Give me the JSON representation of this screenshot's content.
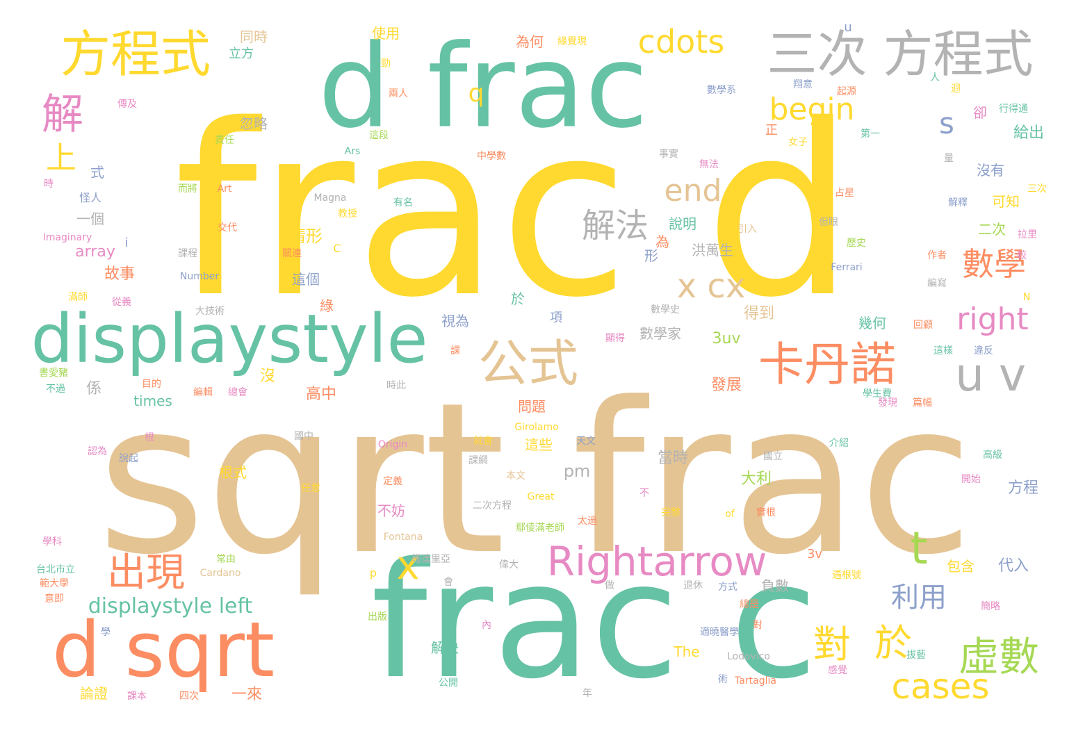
{
  "palette": {
    "green": "#66C2A5",
    "yellow": "#FFD92F",
    "tan": "#E5C494",
    "orange": "#FC8D62",
    "gray": "#B3B3B3",
    "pink": "#E78AC3",
    "lime": "#A6D854",
    "blue": "#8DA0CB"
  },
  "words": [
    {
      "text": "frac d",
      "color": "yellow",
      "weight": 1.0
    },
    {
      "text": "sqrt frac",
      "color": "tan",
      "weight": 0.95
    },
    {
      "text": "frac c",
      "color": "green",
      "weight": 0.9
    },
    {
      "text": "d frac",
      "color": "green",
      "weight": 0.65
    },
    {
      "text": "displaystyle",
      "color": "green",
      "weight": 0.4
    },
    {
      "text": "方程式",
      "color": "yellow",
      "weight": 0.3
    },
    {
      "text": "三次 方程式",
      "color": "gray",
      "weight": 0.3
    },
    {
      "text": "d sqrt",
      "color": "orange",
      "weight": 0.45
    },
    {
      "text": "cdots",
      "color": "yellow",
      "weight": 0.2
    },
    {
      "text": "卡丹諾",
      "color": "orange",
      "weight": 0.3
    },
    {
      "text": "公式",
      "color": "tan",
      "weight": 0.3
    },
    {
      "text": "Rightarrow",
      "color": "pink",
      "weight": 0.25
    },
    {
      "text": "u v",
      "color": "gray",
      "weight": 0.3
    },
    {
      "text": "解法",
      "color": "gray",
      "weight": 0.2
    },
    {
      "text": "x cx",
      "color": "tan",
      "weight": 0.2
    },
    {
      "text": "end",
      "color": "tan",
      "weight": 0.2
    },
    {
      "text": "begin",
      "color": "yellow",
      "weight": 0.18
    },
    {
      "text": "right",
      "color": "pink",
      "weight": 0.18
    },
    {
      "text": "數學",
      "color": "orange",
      "weight": 0.2
    },
    {
      "text": "虛數",
      "color": "lime",
      "weight": 0.25
    },
    {
      "text": "cases",
      "color": "yellow",
      "weight": 0.22
    },
    {
      "text": "出現",
      "color": "orange",
      "weight": 0.2
    },
    {
      "text": "解",
      "color": "pink",
      "weight": 0.2
    },
    {
      "text": "上",
      "color": "yellow",
      "weight": 0.15
    },
    {
      "text": "t",
      "color": "lime",
      "weight": 0.25
    },
    {
      "text": "x",
      "color": "yellow",
      "weight": 0.2
    },
    {
      "text": "q",
      "color": "yellow",
      "weight": 0.15
    },
    {
      "text": "s",
      "color": "blue",
      "weight": 0.15
    },
    {
      "text": "對",
      "color": "yellow",
      "weight": 0.2
    },
    {
      "text": "於",
      "color": "yellow",
      "weight": 0.2
    },
    {
      "text": "利用",
      "color": "blue",
      "weight": 0.15
    },
    {
      "text": "displaystyle left",
      "color": "green",
      "weight": 0.1
    },
    {
      "text": "u",
      "color": "blue",
      "weight": 0.05
    },
    {
      "text": "同時",
      "color": "tan",
      "weight": 0.05
    },
    {
      "text": "使用",
      "color": "yellow",
      "weight": 0.05
    },
    {
      "text": "為何",
      "color": "orange",
      "weight": 0.05
    },
    {
      "text": "緣覺現",
      "color": "yellow",
      "weight": 0.03
    },
    {
      "text": "立方",
      "color": "green",
      "weight": 0.05
    },
    {
      "text": "忽略",
      "color": "gray",
      "weight": 0.05
    },
    {
      "text": "傳及",
      "color": "pink",
      "weight": 0.03
    },
    {
      "text": "勁",
      "color": "yellow",
      "weight": 0.03
    },
    {
      "text": "兩人",
      "color": "orange",
      "weight": 0.03
    },
    {
      "text": "這段",
      "color": "lime",
      "weight": 0.03
    },
    {
      "text": "責任",
      "color": "lime",
      "weight": 0.03
    },
    {
      "text": "Ars",
      "color": "green",
      "weight": 0.03
    },
    {
      "text": "中學數",
      "color": "orange",
      "weight": 0.03
    },
    {
      "text": "式",
      "color": "blue",
      "weight": 0.05
    },
    {
      "text": "時",
      "color": "pink",
      "weight": 0.03
    },
    {
      "text": "怪人",
      "color": "blue",
      "weight": 0.03
    },
    {
      "text": "而將",
      "color": "lime",
      "weight": 0.03
    },
    {
      "text": "Art",
      "color": "orange",
      "weight": 0.03
    },
    {
      "text": "Magna",
      "color": "gray",
      "weight": 0.03
    },
    {
      "text": "有名",
      "color": "green",
      "weight": 0.03
    },
    {
      "text": "教授",
      "color": "yellow",
      "weight": 0.03
    },
    {
      "text": "一個",
      "color": "gray",
      "weight": 0.05
    },
    {
      "text": "交代",
      "color": "orange",
      "weight": 0.03
    },
    {
      "text": "Imaginary",
      "color": "pink",
      "weight": 0.03
    },
    {
      "text": "i",
      "color": "blue",
      "weight": 0.03
    },
    {
      "text": "課程",
      "color": "gray",
      "weight": 0.03
    },
    {
      "text": "關連",
      "color": "orange",
      "weight": 0.03
    },
    {
      "text": "array",
      "color": "pink",
      "weight": 0.06
    },
    {
      "text": "情形",
      "color": "yellow",
      "weight": 0.06
    },
    {
      "text": "C",
      "color": "yellow",
      "weight": 0.03
    },
    {
      "text": "故事",
      "color": "orange",
      "weight": 0.06
    },
    {
      "text": "Number",
      "color": "blue",
      "weight": 0.03
    },
    {
      "text": "這個",
      "color": "blue",
      "weight": 0.05
    },
    {
      "text": "為",
      "color": "orange",
      "weight": 0.05
    },
    {
      "text": "形",
      "color": "blue",
      "weight": 0.05
    },
    {
      "text": "洪萬生",
      "color": "gray",
      "weight": 0.05
    },
    {
      "text": "說明",
      "color": "green",
      "weight": 0.05
    },
    {
      "text": "滿師",
      "color": "yellow",
      "weight": 0.03
    },
    {
      "text": "從義",
      "color": "pink",
      "weight": 0.03
    },
    {
      "text": "大技術",
      "color": "gray",
      "weight": 0.03
    },
    {
      "text": "綠",
      "color": "orange",
      "weight": 0.05
    },
    {
      "text": "於",
      "color": "green",
      "weight": 0.05
    },
    {
      "text": "得到",
      "color": "tan",
      "weight": 0.06
    },
    {
      "text": "視為",
      "color": "blue",
      "weight": 0.05
    },
    {
      "text": "項",
      "color": "blue",
      "weight": 0.04
    },
    {
      "text": "數學家",
      "color": "gray",
      "weight": 0.05
    },
    {
      "text": "幾何",
      "color": "green",
      "weight": 0.05
    },
    {
      "text": "3uv",
      "color": "lime",
      "weight": 0.06
    },
    {
      "text": "數學史",
      "color": "gray",
      "weight": 0.03
    },
    {
      "text": "顯得",
      "color": "pink",
      "weight": 0.03
    },
    {
      "text": "書愛豬",
      "color": "lime",
      "weight": 0.03
    },
    {
      "text": "不過",
      "color": "green",
      "weight": 0.03
    },
    {
      "text": "目的",
      "color": "orange",
      "weight": 0.03
    },
    {
      "text": "係",
      "color": "gray",
      "weight": 0.05
    },
    {
      "text": "沒",
      "color": "yellow",
      "weight": 0.05
    },
    {
      "text": "編輯",
      "color": "orange",
      "weight": 0.03
    },
    {
      "text": "總會",
      "color": "pink",
      "weight": 0.03
    },
    {
      "text": "times",
      "color": "green",
      "weight": 0.06
    },
    {
      "text": "高中",
      "color": "orange",
      "weight": 0.05
    },
    {
      "text": "時此",
      "color": "gray",
      "weight": 0.03
    },
    {
      "text": "問題",
      "color": "orange",
      "weight": 0.05
    },
    {
      "text": "發展",
      "color": "orange",
      "weight": 0.05
    },
    {
      "text": "課",
      "color": "orange",
      "weight": 0.03
    },
    {
      "text": "根",
      "color": "pink",
      "weight": 0.03
    },
    {
      "text": "認為",
      "color": "pink",
      "weight": 0.03
    },
    {
      "text": "說起",
      "color": "blue",
      "weight": 0.03
    },
    {
      "text": "國中",
      "color": "gray",
      "weight": 0.03
    },
    {
      "text": "根式",
      "color": "yellow",
      "weight": 0.05
    },
    {
      "text": "Origin",
      "color": "pink",
      "weight": 0.03
    },
    {
      "text": "這些",
      "color": "yellow",
      "weight": 0.05
    },
    {
      "text": "pm",
      "color": "gray",
      "weight": 0.06
    },
    {
      "text": "天文",
      "color": "blue",
      "weight": 0.03
    },
    {
      "text": "Girolamo",
      "color": "yellow",
      "weight": 0.03
    },
    {
      "text": "就會",
      "color": "yellow",
      "weight": 0.03
    },
    {
      "text": "課綱",
      "color": "gray",
      "weight": 0.03
    },
    {
      "text": "當時",
      "color": "gray",
      "weight": 0.05
    },
    {
      "text": "大利",
      "color": "lime",
      "weight": 0.05
    },
    {
      "text": "任意",
      "color": "yellow",
      "weight": 0.03
    },
    {
      "text": "定義",
      "color": "orange",
      "weight": 0.03
    },
    {
      "text": "本文",
      "color": "tan",
      "weight": 0.03
    },
    {
      "text": "不妨",
      "color": "pink",
      "weight": 0.05
    },
    {
      "text": "二次方程",
      "color": "gray",
      "weight": 0.03
    },
    {
      "text": "Great",
      "color": "yellow",
      "weight": 0.03
    },
    {
      "text": "不",
      "color": "pink",
      "weight": 0.03
    },
    {
      "text": "太過",
      "color": "orange",
      "weight": 0.03
    },
    {
      "text": "完整",
      "color": "yellow",
      "weight": 0.03
    },
    {
      "text": "of",
      "color": "yellow",
      "weight": 0.03
    },
    {
      "text": "實根",
      "color": "orange",
      "weight": 0.03
    },
    {
      "text": "方程",
      "color": "blue",
      "weight": 0.06
    },
    {
      "text": "學科",
      "color": "pink",
      "weight": 0.03
    },
    {
      "text": "Fontana",
      "color": "tan",
      "weight": 0.03
    },
    {
      "text": "鄢倰滿老師",
      "color": "lime",
      "weight": 0.03
    },
    {
      "text": "台北市立",
      "color": "green",
      "weight": 0.03
    },
    {
      "text": "範大學",
      "color": "orange",
      "weight": 0.03
    },
    {
      "text": "常由",
      "color": "lime",
      "weight": 0.03
    },
    {
      "text": "Cardano",
      "color": "tan",
      "weight": 0.03
    },
    {
      "text": "p",
      "color": "yellow",
      "weight": 0.04
    },
    {
      "text": "塔達里亞",
      "color": "gray",
      "weight": 0.03
    },
    {
      "text": "偉大",
      "color": "gray",
      "weight": 0.03
    },
    {
      "text": "會",
      "color": "gray",
      "weight": 0.03
    },
    {
      "text": "3v",
      "color": "orange",
      "weight": 0.05
    },
    {
      "text": "負數",
      "color": "gray",
      "weight": 0.05
    },
    {
      "text": "包含",
      "color": "yellow",
      "weight": 0.05
    },
    {
      "text": "代入",
      "color": "blue",
      "weight": 0.06
    },
    {
      "text": "意即",
      "color": "orange",
      "weight": 0.03
    },
    {
      "text": "學",
      "color": "blue",
      "weight": 0.03
    },
    {
      "text": "出版",
      "color": "lime",
      "weight": 0.03
    },
    {
      "text": "內",
      "color": "pink",
      "weight": 0.03
    },
    {
      "text": "解決",
      "color": "green",
      "weight": 0.05
    },
    {
      "text": "The",
      "color": "yellow",
      "weight": 0.05
    },
    {
      "text": "退休",
      "color": "gray",
      "weight": 0.03
    },
    {
      "text": "方式",
      "color": "blue",
      "weight": 0.03
    },
    {
      "text": "做",
      "color": "gray",
      "weight": 0.03
    },
    {
      "text": "總是",
      "color": "orange",
      "weight": 0.03
    },
    {
      "text": "遇根號",
      "color": "yellow",
      "weight": 0.03
    },
    {
      "text": "簡略",
      "color": "pink",
      "weight": 0.03
    },
    {
      "text": "適曉醫學",
      "color": "blue",
      "weight": 0.03
    },
    {
      "text": "對",
      "color": "orange",
      "weight": 0.03
    },
    {
      "text": "Lodovico",
      "color": "gray",
      "weight": 0.03
    },
    {
      "text": "論證",
      "color": "yellow",
      "weight": 0.05
    },
    {
      "text": "課本",
      "color": "pink",
      "weight": 0.03
    },
    {
      "text": "四次",
      "color": "orange",
      "weight": 0.03
    },
    {
      "text": "一來",
      "color": "orange",
      "weight": 0.05
    },
    {
      "text": "公開",
      "color": "green",
      "weight": 0.03
    },
    {
      "text": "年",
      "color": "gray",
      "weight": 0.03
    },
    {
      "text": "術",
      "color": "blue",
      "weight": 0.03
    },
    {
      "text": "Tartaglia",
      "color": "orange",
      "weight": 0.03
    },
    {
      "text": "拔藝",
      "color": "green",
      "weight": 0.03
    },
    {
      "text": "感覺",
      "color": "pink",
      "weight": 0.03
    },
    {
      "text": "翔意",
      "color": "blue",
      "weight": 0.03
    },
    {
      "text": "起源",
      "color": "orange",
      "weight": 0.03
    },
    {
      "text": "數學系",
      "color": "blue",
      "weight": 0.03
    },
    {
      "text": "人",
      "color": "green",
      "weight": 0.03
    },
    {
      "text": "迴",
      "color": "yellow",
      "weight": 0.03
    },
    {
      "text": "卻",
      "color": "pink",
      "weight": 0.04
    },
    {
      "text": "行得通",
      "color": "green",
      "weight": 0.03
    },
    {
      "text": "給出",
      "color": "green",
      "weight": 0.05
    },
    {
      "text": "第一",
      "color": "green",
      "weight": 0.03
    },
    {
      "text": "正",
      "color": "orange",
      "weight": 0.04
    },
    {
      "text": "女子",
      "color": "yellow",
      "weight": 0.03
    },
    {
      "text": "事實",
      "color": "gray",
      "weight": 0.03
    },
    {
      "text": "量",
      "color": "gray",
      "weight": 0.03
    },
    {
      "text": "無法",
      "color": "pink",
      "weight": 0.03
    },
    {
      "text": "沒有",
      "color": "blue",
      "weight": 0.05
    },
    {
      "text": "占星",
      "color": "orange",
      "weight": 0.03
    },
    {
      "text": "解釋",
      "color": "blue",
      "weight": 0.03
    },
    {
      "text": "三次",
      "color": "yellow",
      "weight": 0.03
    },
    {
      "text": "可知",
      "color": "yellow",
      "weight": 0.05
    },
    {
      "text": "但眼",
      "color": "gray",
      "weight": 0.03
    },
    {
      "text": "引入",
      "color": "tan",
      "weight": 0.03
    },
    {
      "text": "二次",
      "color": "lime",
      "weight": 0.05
    },
    {
      "text": "拉里",
      "color": "pink",
      "weight": 0.03
    },
    {
      "text": "歷史",
      "color": "lime",
      "weight": 0.03
    },
    {
      "text": "Ferrari",
      "color": "blue",
      "weight": 0.03
    },
    {
      "text": "作者",
      "color": "orange",
      "weight": 0.03
    },
    {
      "text": "較",
      "color": "pink",
      "weight": 0.03
    },
    {
      "text": "編寫",
      "color": "gray",
      "weight": 0.03
    },
    {
      "text": "N",
      "color": "yellow",
      "weight": 0.03
    },
    {
      "text": "回顧",
      "color": "orange",
      "weight": 0.03
    },
    {
      "text": "這樣",
      "color": "green",
      "weight": 0.03
    },
    {
      "text": "違反",
      "color": "blue",
      "weight": 0.03
    },
    {
      "text": "學生費",
      "color": "green",
      "weight": 0.03
    },
    {
      "text": "發現",
      "color": "pink",
      "weight": 0.03
    },
    {
      "text": "篇幅",
      "color": "orange",
      "weight": 0.03
    },
    {
      "text": "介紹",
      "color": "green",
      "weight": 0.03
    },
    {
      "text": "國立",
      "color": "gray",
      "weight": 0.03
    },
    {
      "text": "高級",
      "color": "green",
      "weight": 0.03
    },
    {
      "text": "開始",
      "color": "pink",
      "weight": 0.03
    }
  ]
}
